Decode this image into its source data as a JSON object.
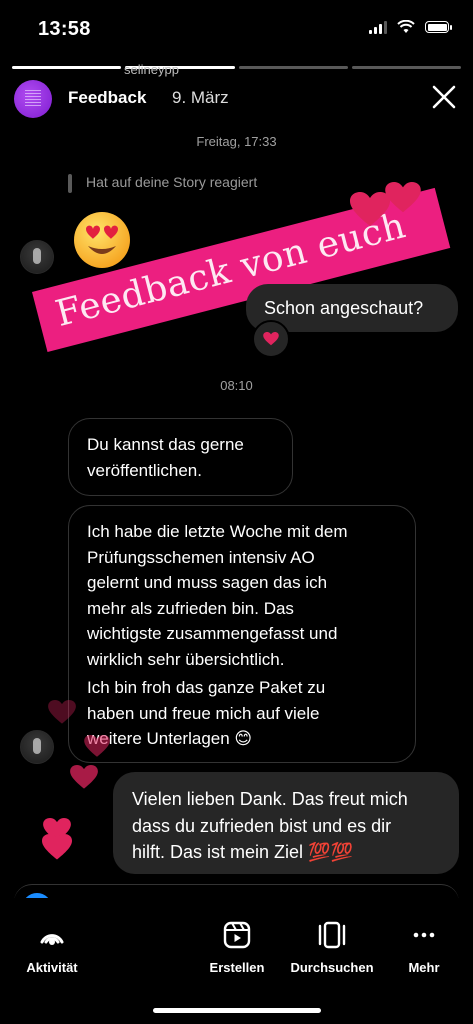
{
  "status_bar": {
    "time": "13:58"
  },
  "story": {
    "ghost_username": "selineypp",
    "name": "Feedback",
    "date": "9. März",
    "progress_segments": [
      1,
      1,
      0,
      0
    ]
  },
  "chat": {
    "timestamp_1": "Freitag, 17:33",
    "reply_note": "Hat auf deine Story reagiert",
    "sticker_text": "Feedback von euch",
    "msg_out_1": "Schon angeschaut?",
    "timestamp_2": "08:10",
    "msg_in_1_lines": [
      "Du kannst das gerne",
      "veröffentlichen."
    ],
    "msg_in_2_lines": [
      "Ich habe die letzte Woche mit dem",
      "Prüfungsschemen intensiv AO",
      "gelernt und muss sagen das ich",
      "mehr als zufrieden bin. Das",
      "wichtigste zusammengefasst und",
      "wirklich sehr übersichtlich.",
      "Ich bin froh das ganze Paket zu",
      "haben und freue mich auf viele",
      "weitere Unterlagen 😊"
    ],
    "msg_out_2_lines": [
      "Vielen lieben Dank. Das freut mich",
      "dass du zufrieden bist und es dir",
      "hilft. Das ist mein Ziel 💯💯"
    ]
  },
  "tabbar": {
    "items": [
      {
        "label": "Aktivität",
        "icon": "activity-icon"
      },
      {
        "label": "Erstellen",
        "icon": "create-icon"
      },
      {
        "label": "Durchsuchen",
        "icon": "browse-icon"
      },
      {
        "label": "Mehr",
        "icon": "more-icon"
      }
    ]
  },
  "colors": {
    "sticker": "#ec1f80",
    "bubble_out": "#262626",
    "heart": "#e0245e"
  }
}
